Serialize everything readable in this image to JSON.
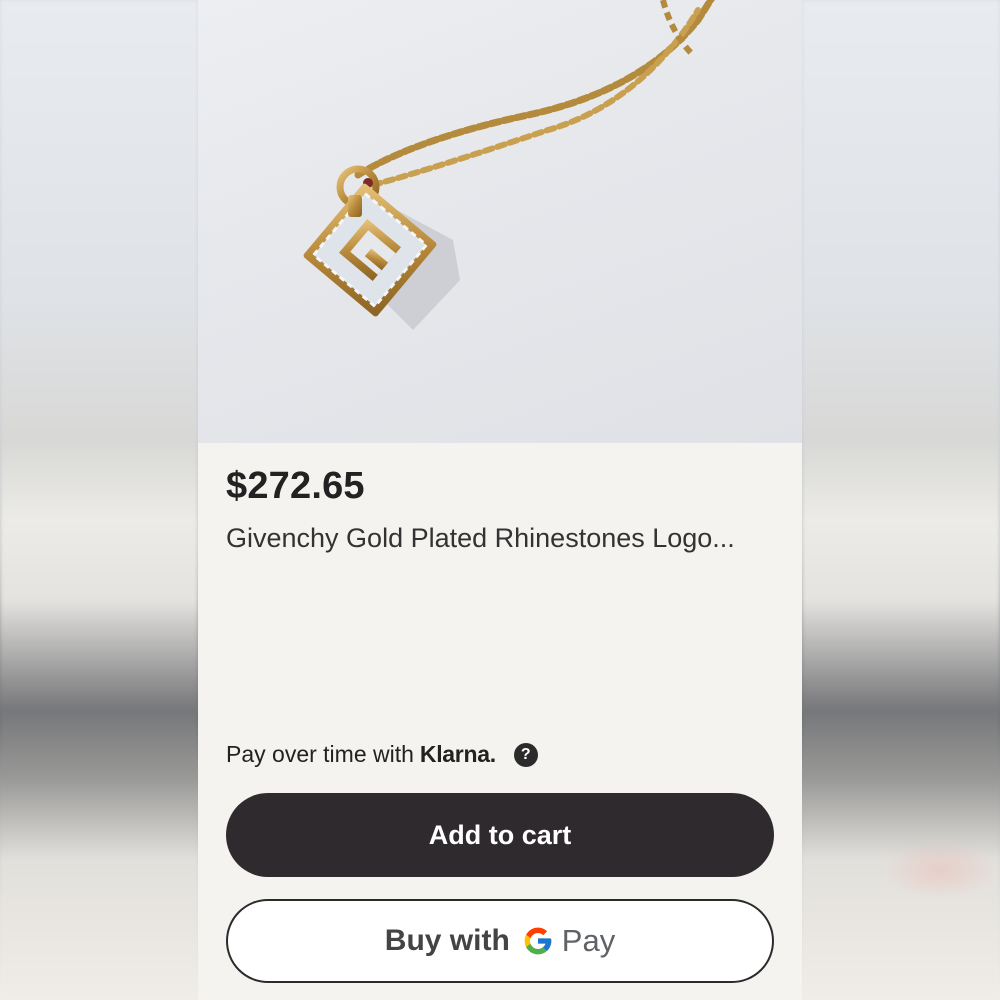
{
  "product": {
    "price": "$272.65",
    "title": "Givenchy Gold Plated Rhinestones Logo..."
  },
  "klarna": {
    "prefix": "Pay over time with",
    "brand": "Klarna.",
    "help_icon": "question-mark-icon"
  },
  "actions": {
    "add_to_cart": "Add to cart",
    "gpay_prefix": "Buy with",
    "gpay_suffix": "Pay"
  },
  "colors": {
    "primary_button": "#2f2a2e",
    "background": "#f4f3f0",
    "text": "#222222"
  }
}
